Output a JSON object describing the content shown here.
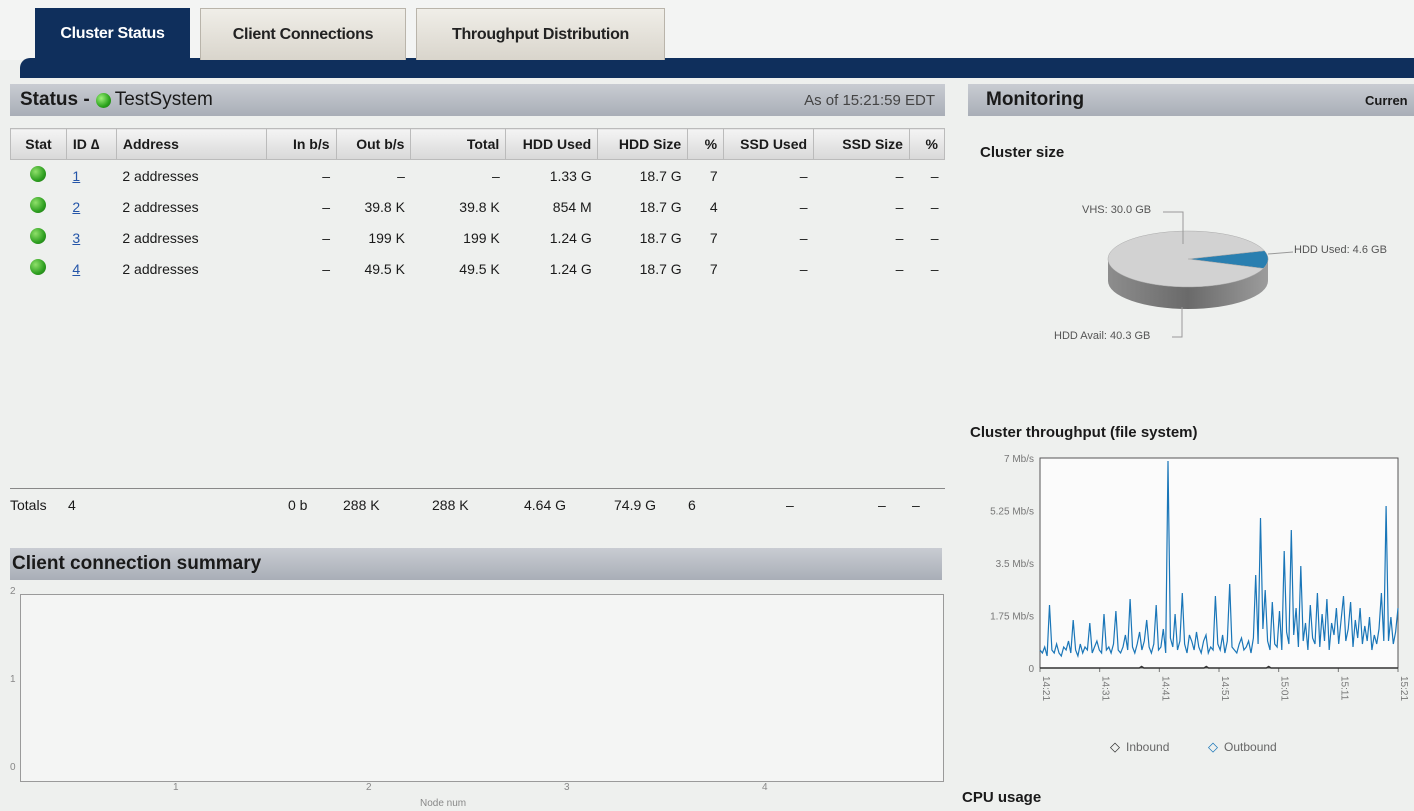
{
  "tabs": [
    {
      "label": "Cluster Status",
      "active": true
    },
    {
      "label": "Client Connections",
      "active": false
    },
    {
      "label": "Throughput Distribution",
      "active": false
    }
  ],
  "status": {
    "prefix": "Status -",
    "system_name": "TestSystem",
    "as_of": "As of 15:21:59 EDT"
  },
  "table": {
    "columns": [
      "Stat",
      "ID ∆",
      "Address",
      "In b/s",
      "Out b/s",
      "Total",
      "HDD Used",
      "HDD Size",
      "%",
      "SSD Used",
      "SSD Size",
      "%"
    ],
    "rows": [
      {
        "id": "1",
        "address": "2 addresses",
        "in": "–",
        "out": "–",
        "total": "–",
        "hdd_used": "1.33 G",
        "hdd_size": "18.7 G",
        "pct": "7",
        "ssd_used": "–",
        "ssd_size": "–",
        "ssd_pct": "–"
      },
      {
        "id": "2",
        "address": "2 addresses",
        "in": "–",
        "out": "39.8 K",
        "total": "39.8 K",
        "hdd_used": "854 M",
        "hdd_size": "18.7 G",
        "pct": "4",
        "ssd_used": "–",
        "ssd_size": "–",
        "ssd_pct": "–"
      },
      {
        "id": "3",
        "address": "2 addresses",
        "in": "–",
        "out": "199 K",
        "total": "199 K",
        "hdd_used": "1.24 G",
        "hdd_size": "18.7 G",
        "pct": "7",
        "ssd_used": "–",
        "ssd_size": "–",
        "ssd_pct": "–"
      },
      {
        "id": "4",
        "address": "2 addresses",
        "in": "–",
        "out": "49.5 K",
        "total": "49.5 K",
        "hdd_used": "1.24 G",
        "hdd_size": "18.7 G",
        "pct": "7",
        "ssd_used": "–",
        "ssd_size": "–",
        "ssd_pct": "–"
      }
    ],
    "totals": {
      "label": "Totals",
      "count": "4",
      "in": "0 b",
      "out": "288 K",
      "total": "288 K",
      "hdd_used": "4.64 G",
      "hdd_size": "74.9 G",
      "pct": "6",
      "ssd_used": "–",
      "ssd_size": "–",
      "ssd_pct": "–"
    }
  },
  "client_summary": {
    "title": "Client connection summary",
    "y_ticks": [
      "2",
      "1",
      "0"
    ],
    "x_ticks": [
      "1",
      "2",
      "3",
      "4"
    ],
    "x_label": "Node num"
  },
  "monitoring": {
    "title": "Monitoring",
    "right_text": "Curren",
    "cluster_size_title": "Cluster size",
    "throughput_title": "Cluster throughput (file system)",
    "cpu_title": "CPU usage"
  },
  "chart_data": [
    {
      "type": "pie",
      "title": "Cluster size",
      "slices": [
        {
          "label": "HDD Used: 4.6 GB",
          "value": 4.6,
          "color": "#2a7fb0"
        },
        {
          "label": "HDD Avail: 40.3 GB",
          "value": 40.3,
          "color": "#b5b5b5"
        }
      ],
      "annotations": [
        "VHS: 30.0 GB"
      ]
    },
    {
      "type": "line",
      "title": "Cluster throughput (file system)",
      "y_ticks": [
        "7 Mb/s",
        "5.25 Mb/s",
        "3.5 Mb/s",
        "1.75 Mb/s",
        "0"
      ],
      "ylim": [
        0,
        7
      ],
      "x_ticks": [
        "14:21",
        "14:31",
        "14:41",
        "14:51",
        "15:01",
        "15:11",
        "15:21"
      ],
      "legend": [
        "Inbound",
        "Outbound"
      ],
      "series": [
        {
          "name": "Inbound",
          "color": "#333333",
          "values": [
            0,
            0,
            0,
            0,
            0,
            0,
            0,
            0,
            0,
            0,
            0,
            0,
            0,
            0,
            0,
            0,
            0,
            0,
            0,
            0,
            0,
            0,
            0,
            0,
            0,
            0,
            0,
            0,
            0,
            0,
            0,
            0,
            0,
            0,
            0,
            0,
            0,
            0,
            0,
            0,
            0,
            0,
            0,
            0,
            0.05,
            0,
            0,
            0,
            0,
            0,
            0,
            0,
            0,
            0,
            0,
            0,
            0,
            0,
            0,
            0,
            0,
            0,
            0,
            0,
            0,
            0,
            0,
            0,
            0,
            0,
            0,
            0,
            0.05,
            0,
            0,
            0,
            0,
            0,
            0,
            0,
            0,
            0,
            0,
            0,
            0,
            0,
            0,
            0,
            0,
            0,
            0,
            0,
            0,
            0,
            0,
            0,
            0,
            0,
            0,
            0.05,
            0,
            0,
            0,
            0,
            0,
            0,
            0,
            0,
            0,
            0,
            0,
            0,
            0,
            0,
            0,
            0,
            0,
            0,
            0,
            0,
            0,
            0,
            0,
            0,
            0,
            0,
            0,
            0,
            0,
            0,
            0,
            0,
            0,
            0,
            0,
            0,
            0,
            0,
            0,
            0,
            0,
            0,
            0,
            0,
            0,
            0,
            0,
            0,
            0,
            0,
            0,
            0,
            0,
            0,
            0,
            0
          ]
        },
        {
          "name": "Outbound",
          "color": "#1a76b8",
          "values": [
            0.6,
            0.5,
            0.7,
            0.4,
            2.1,
            0.6,
            0.5,
            0.8,
            0.5,
            0.4,
            0.7,
            0.6,
            0.9,
            0.5,
            1.6,
            0.6,
            0.4,
            0.8,
            0.5,
            0.7,
            0.6,
            1.5,
            0.5,
            0.7,
            0.9,
            0.6,
            0.5,
            1.8,
            0.6,
            0.7,
            0.5,
            0.8,
            1.9,
            0.6,
            0.5,
            0.7,
            1.1,
            0.6,
            2.3,
            0.7,
            0.5,
            0.8,
            1.2,
            0.6,
            0.9,
            1.6,
            0.7,
            0.5,
            0.8,
            2.1,
            0.6,
            0.7,
            1.3,
            0.5,
            6.9,
            1.0,
            0.7,
            1.8,
            0.6,
            0.9,
            2.5,
            0.8,
            0.5,
            1.1,
            0.9,
            0.6,
            1.2,
            0.7,
            0.5,
            0.9,
            1.1,
            0.5,
            0.7,
            0.6,
            2.4,
            0.8,
            0.6,
            1.1,
            0.5,
            0.9,
            2.8,
            0.7,
            0.6,
            0.5,
            0.8,
            1.0,
            0.6,
            0.7,
            0.9,
            0.5,
            1.0,
            3.1,
            0.8,
            5.0,
            1.3,
            2.6,
            0.9,
            0.6,
            2.2,
            0.8,
            0.7,
            1.9,
            0.6,
            3.9,
            1.2,
            0.8,
            4.6,
            1.1,
            2.0,
            0.7,
            3.4,
            0.9,
            1.5,
            0.6,
            2.1,
            1.0,
            0.8,
            2.5,
            0.7,
            1.8,
            0.9,
            2.3,
            0.6,
            1.5,
            1.1,
            2.0,
            0.8,
            1.6,
            2.4,
            0.9,
            1.3,
            2.2,
            0.7,
            1.6,
            1.0,
            2.0,
            0.8,
            1.4,
            0.9,
            1.7,
            0.6,
            1.1,
            0.8,
            1.3,
            2.5,
            0.9,
            5.4,
            0.9,
            1.7,
            0.8,
            1.2,
            2.0
          ]
        }
      ]
    }
  ]
}
